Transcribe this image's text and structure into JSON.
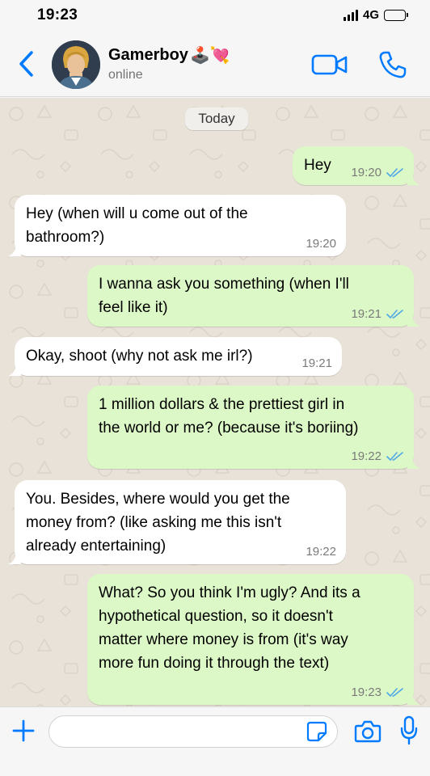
{
  "status_bar": {
    "time": "19:23",
    "network": "4G"
  },
  "header": {
    "contact_name": "Gamerboy",
    "contact_emoji": "🕹️💘",
    "contact_status": "online",
    "icons": {
      "back": "chevron-left-icon",
      "video": "video-call-icon",
      "call": "phone-icon"
    }
  },
  "chat": {
    "date_label": "Today",
    "messages": [
      {
        "direction": "out",
        "text": "Hey",
        "time": "19:20",
        "read": true
      },
      {
        "direction": "in",
        "text": "Hey (when will u come out of the\nbathroom?)",
        "time": "19:20"
      },
      {
        "direction": "out",
        "text": "I wanna ask you something (when I'll\nfeel like it)",
        "time": "19:21",
        "read": true
      },
      {
        "direction": "in",
        "text": "Okay, shoot (why not ask me irl?)",
        "time": "19:21"
      },
      {
        "direction": "out",
        "text": "1 million dollars & the prettiest girl in\nthe world or me? (because it's boriing)",
        "time": "19:22",
        "read": true
      },
      {
        "direction": "in",
        "text": "You. Besides, where would you get the\nmoney from? (like asking me this isn't\nalready entertaining)",
        "time": "19:22"
      },
      {
        "direction": "out",
        "text": "What? So you think I'm ugly? And its a\nhypothetical question, so it doesn't\nmatter where money is from (it's way\nmore fun doing it through the text)",
        "time": "19:23",
        "read": true
      }
    ]
  },
  "composer": {
    "input_value": "",
    "icons": {
      "attach": "plus-icon",
      "sticker": "sticker-icon",
      "camera": "camera-icon",
      "mic": "microphone-icon"
    }
  },
  "colors": {
    "accent": "#007aff",
    "outgoing_bubble": "#dcf8c6",
    "incoming_bubble": "#ffffff",
    "read_ticks": "#4fa8e8",
    "wallpaper": "#e8e2d8"
  }
}
